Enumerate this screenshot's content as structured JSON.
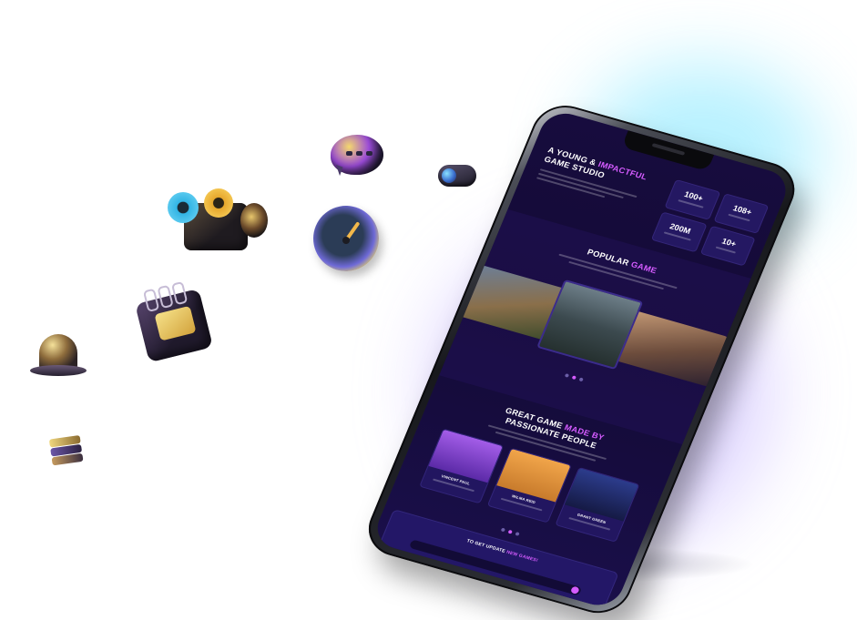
{
  "hero": {
    "title_line1": "A YOUNG &",
    "title_accent": "IMPACTFUL",
    "title_line2": "GAME STUDIO",
    "stats": [
      {
        "value": "100+",
        "label": ""
      },
      {
        "value": "108+",
        "label": ""
      },
      {
        "value": "200M",
        "label": ""
      },
      {
        "value": "10+",
        "label": ""
      }
    ]
  },
  "popular": {
    "title": "POPULAR",
    "title_accent": "GAME"
  },
  "team": {
    "title_line1": "GREAT GAME",
    "title_accent": "MADE BY",
    "title_line2": "PASSIONATE PEOPLE",
    "members": [
      {
        "name": "VINCENT PAUL",
        "role": ""
      },
      {
        "name": "WILMA REID",
        "role": ""
      },
      {
        "name": "GRANT GREEN",
        "role": ""
      }
    ]
  },
  "newsletter": {
    "title": "TO GET UPDATE",
    "title_accent": "NEW GAMES!"
  },
  "colors": {
    "accent": "#d55cff",
    "screen_bg": "#170c3e",
    "glow_cyan": "#7ee6ff",
    "glow_violet": "#c6b6ff"
  },
  "icons": [
    "chat-bubble-icon",
    "toggle-icon",
    "camera-icon",
    "clock-icon",
    "calendar-icon",
    "bell-icon",
    "cards-icon"
  ]
}
